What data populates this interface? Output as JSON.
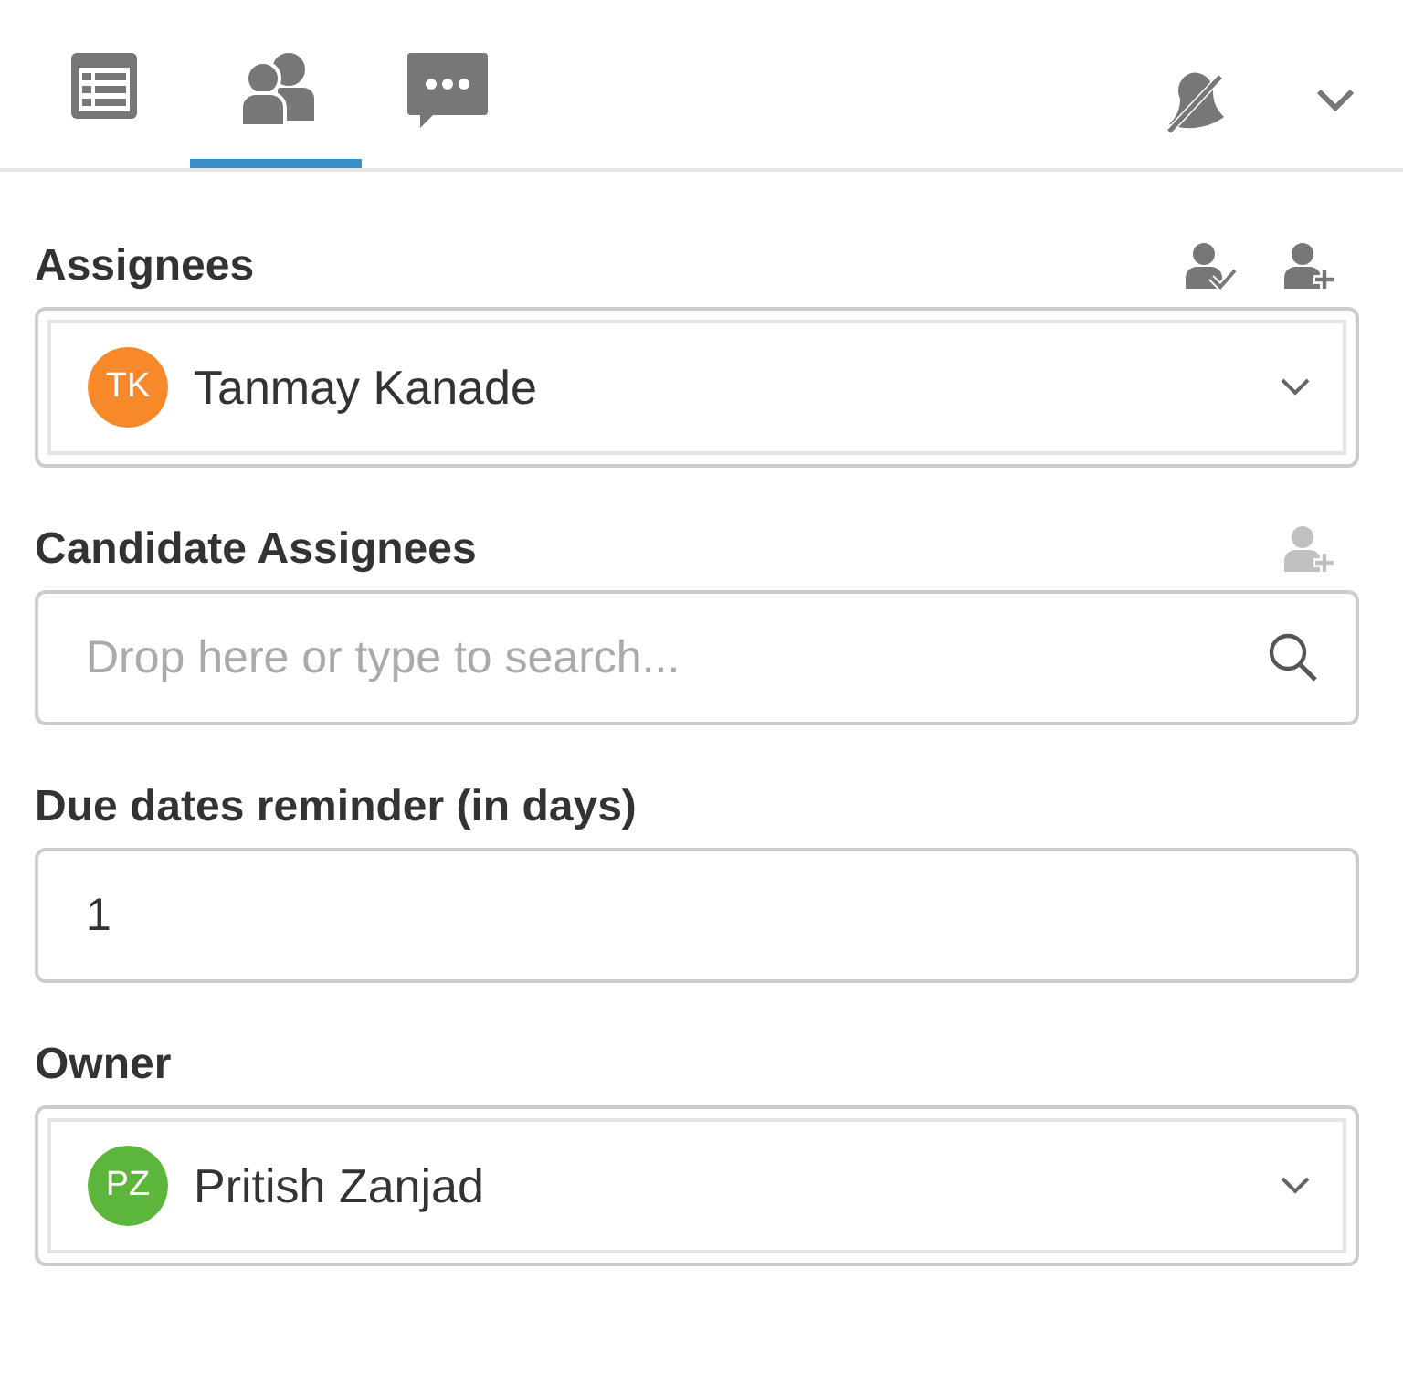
{
  "tabs": [
    {
      "kind": "table",
      "selected": false
    },
    {
      "kind": "people",
      "selected": true
    },
    {
      "kind": "chat",
      "selected": false
    }
  ],
  "sections": [
    {
      "kind": "picker",
      "label": "Assignees",
      "actions": [
        {
          "kind": "check",
          "disabled": false
        },
        {
          "kind": "add",
          "disabled": false
        }
      ],
      "person": {
        "initials": "TK",
        "name": "Tanmay Kanade",
        "color": "#f7892b"
      }
    },
    {
      "kind": "search",
      "label": "Candidate Assignees",
      "actions": [
        {
          "kind": "add",
          "disabled": true
        }
      ],
      "placeholder": "Drop here or type to search..."
    },
    {
      "kind": "input",
      "label": "Due dates reminder (in days)",
      "value": "1"
    },
    {
      "kind": "picker",
      "label": "Owner",
      "person": {
        "initials": "PZ",
        "name": "Pritish Zanjad",
        "color": "#5cb63b"
      }
    }
  ]
}
